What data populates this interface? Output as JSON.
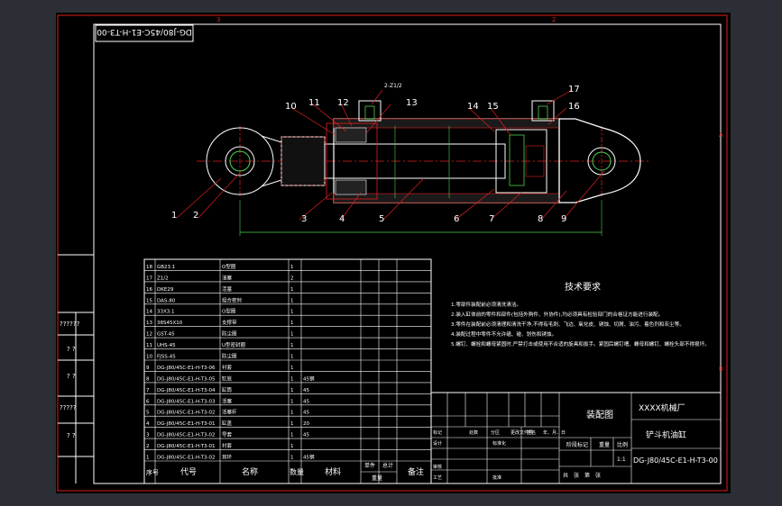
{
  "drawing_number_rotated": "DG-J80/45C-E1-H-T3-00",
  "callouts": [
    "1",
    "2",
    "3",
    "4",
    "5",
    "6",
    "7",
    "8",
    "9",
    "10",
    "11",
    "12",
    "13",
    "14",
    "15",
    "16",
    "17"
  ],
  "port_thread_label": "2-Z1/2",
  "bom": {
    "rows": [
      {
        "no": "18",
        "code": "GB23.1",
        "name": "O型圈",
        "qty": "1",
        "material": ""
      },
      {
        "no": "17",
        "code": "Z1/2",
        "name": "油塞",
        "qty": "2",
        "material": ""
      },
      {
        "no": "16",
        "code": "DKE29",
        "name": "活塞",
        "qty": "1",
        "material": ""
      },
      {
        "no": "15",
        "code": "DAS-80",
        "name": "组合密封",
        "qty": "1",
        "material": ""
      },
      {
        "no": "14",
        "code": "33X3.1",
        "name": "O型圈",
        "qty": "1",
        "material": ""
      },
      {
        "no": "13",
        "code": "38S45X10",
        "name": "支撑带",
        "qty": "1",
        "material": ""
      },
      {
        "no": "12",
        "code": "GST-45",
        "name": "防尘圈",
        "qty": "1",
        "material": ""
      },
      {
        "no": "11",
        "code": "UHS-45",
        "name": "U型密封圈",
        "qty": "1",
        "material": ""
      },
      {
        "no": "10",
        "code": "FJSS-45",
        "name": "防尘圈",
        "qty": "1",
        "material": ""
      },
      {
        "no": "9",
        "code": "DG-J80/45C-E1-H-T3-06",
        "name": "衬套",
        "qty": "1",
        "material": ""
      },
      {
        "no": "8",
        "code": "DG-J80/45C-E1-H-T3-05",
        "name": "缸底",
        "qty": "1",
        "material": "45钢"
      },
      {
        "no": "7",
        "code": "DG-J80/45C-E1-H-T3-04",
        "name": "缸筒",
        "qty": "1",
        "material": "45"
      },
      {
        "no": "6",
        "code": "DG-J80/45C-E1-H-T3-03",
        "name": "活塞",
        "qty": "1",
        "material": "45"
      },
      {
        "no": "5",
        "code": "DG-J80/45C-E1-H-T3-02",
        "name": "活塞杆",
        "qty": "1",
        "material": "45"
      },
      {
        "no": "4",
        "code": "DG-J80/45C-E1-H-T3-01",
        "name": "缸盖",
        "qty": "1",
        "material": "20"
      },
      {
        "no": "3",
        "code": "DG-J80/45C-E1-H-T3-02",
        "name": "导套",
        "qty": "1",
        "material": "45"
      },
      {
        "no": "2",
        "code": "DG-J80/45C-E1-H-T3-01",
        "name": "衬套",
        "qty": "1",
        "material": ""
      },
      {
        "no": "1",
        "code": "DG-J80/45C-E1-H-T3-02",
        "name": "耳环",
        "qty": "1",
        "material": "45钢"
      }
    ],
    "headers": {
      "no": "序号",
      "code": "代号",
      "name": "名称",
      "qty": "数量",
      "material": "材料",
      "single": "单件",
      "total": "总计",
      "weight": "重量",
      "remark": "备注"
    }
  },
  "tech_requirements": {
    "title": "技术要求",
    "items": [
      "1.零部件装配前必须清洗清洁。",
      "2.装入缸体前的零件和部件(包括外购件、外协件),均必须具有检验部门的合格证方能进行装配。",
      "3.零件在装配前必须清理和清洗干净,不得有毛刺、飞边、氧化皮、锈蚀、切屑、油污、着色剂和灰尘等。",
      "4.装配过程中零件不允许磕、碰、划伤和锈蚀。",
      "5.螺钉、螺栓和螺母紧固时,严禁打击或使用不合适的旋具和扳手。紧固后螺钉槽、螺母和螺钉、螺栓头部不得损坏。"
    ]
  },
  "title_block": {
    "company": "XXXX机械厂",
    "drawing_type": "装配图",
    "part_name": "铲斗机油缸",
    "drawing_number": "DG-J80/45C-E1-H-T3-00",
    "scale": "1:1",
    "scale_label": "比例",
    "stage_label": "阶段标记",
    "weight_label": "重量",
    "sheet_row": "共　张　第　张",
    "row_labels": [
      "标记",
      "处数",
      "分区",
      "更改文件号",
      "签名",
      "年、月、日"
    ],
    "left_labels": [
      "设计",
      "审核",
      "工艺"
    ],
    "mid_labels": [
      "标准化",
      "批准"
    ]
  },
  "left_margin_labels": [
    "??????",
    "? ?",
    "? ?",
    "?????",
    "? ?"
  ],
  "zone_labels": {
    "top": [
      "3",
      "2"
    ],
    "right": [
      "A",
      "B"
    ]
  }
}
